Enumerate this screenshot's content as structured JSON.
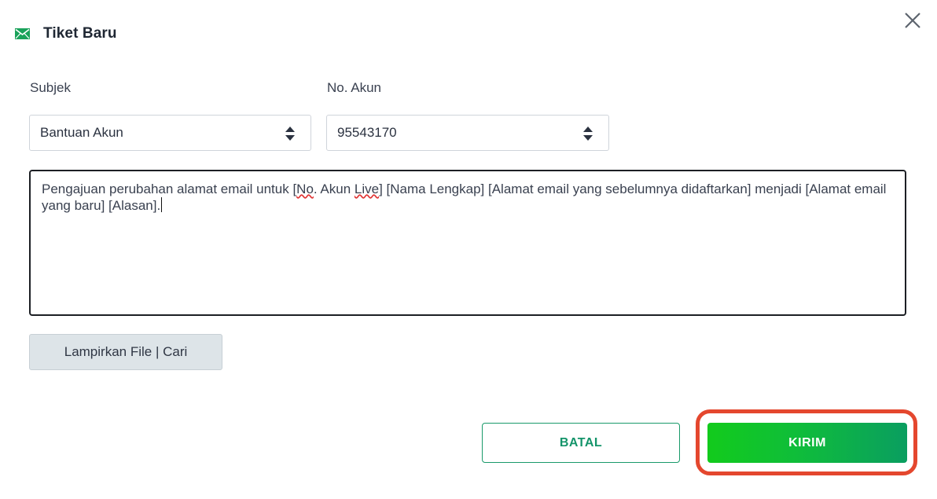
{
  "header": {
    "title": "Tiket Baru",
    "icon": "mail-icon",
    "accent_color": "#1aa25a"
  },
  "close": {
    "icon": "close-icon"
  },
  "form": {
    "subject": {
      "label": "Subjek",
      "value": "Bantuan Akun"
    },
    "account": {
      "label": "No. Akun",
      "value": "95543170"
    },
    "message": {
      "text_before": "Pengajuan perubahan alamat email untuk [",
      "word_no": "No",
      "text_mid": ". Akun ",
      "word_live": "Live",
      "text_after": "] [Nama Lengkap] [Alamat email yang sebelumnya didaftarkan] menjadi [Alamat email yang baru] [Alasan]."
    },
    "attach_label": "Lampirkan File | Cari"
  },
  "footer": {
    "cancel_label": "BATAL",
    "submit_label": "KIRIM",
    "highlight_color": "#e4472e"
  }
}
